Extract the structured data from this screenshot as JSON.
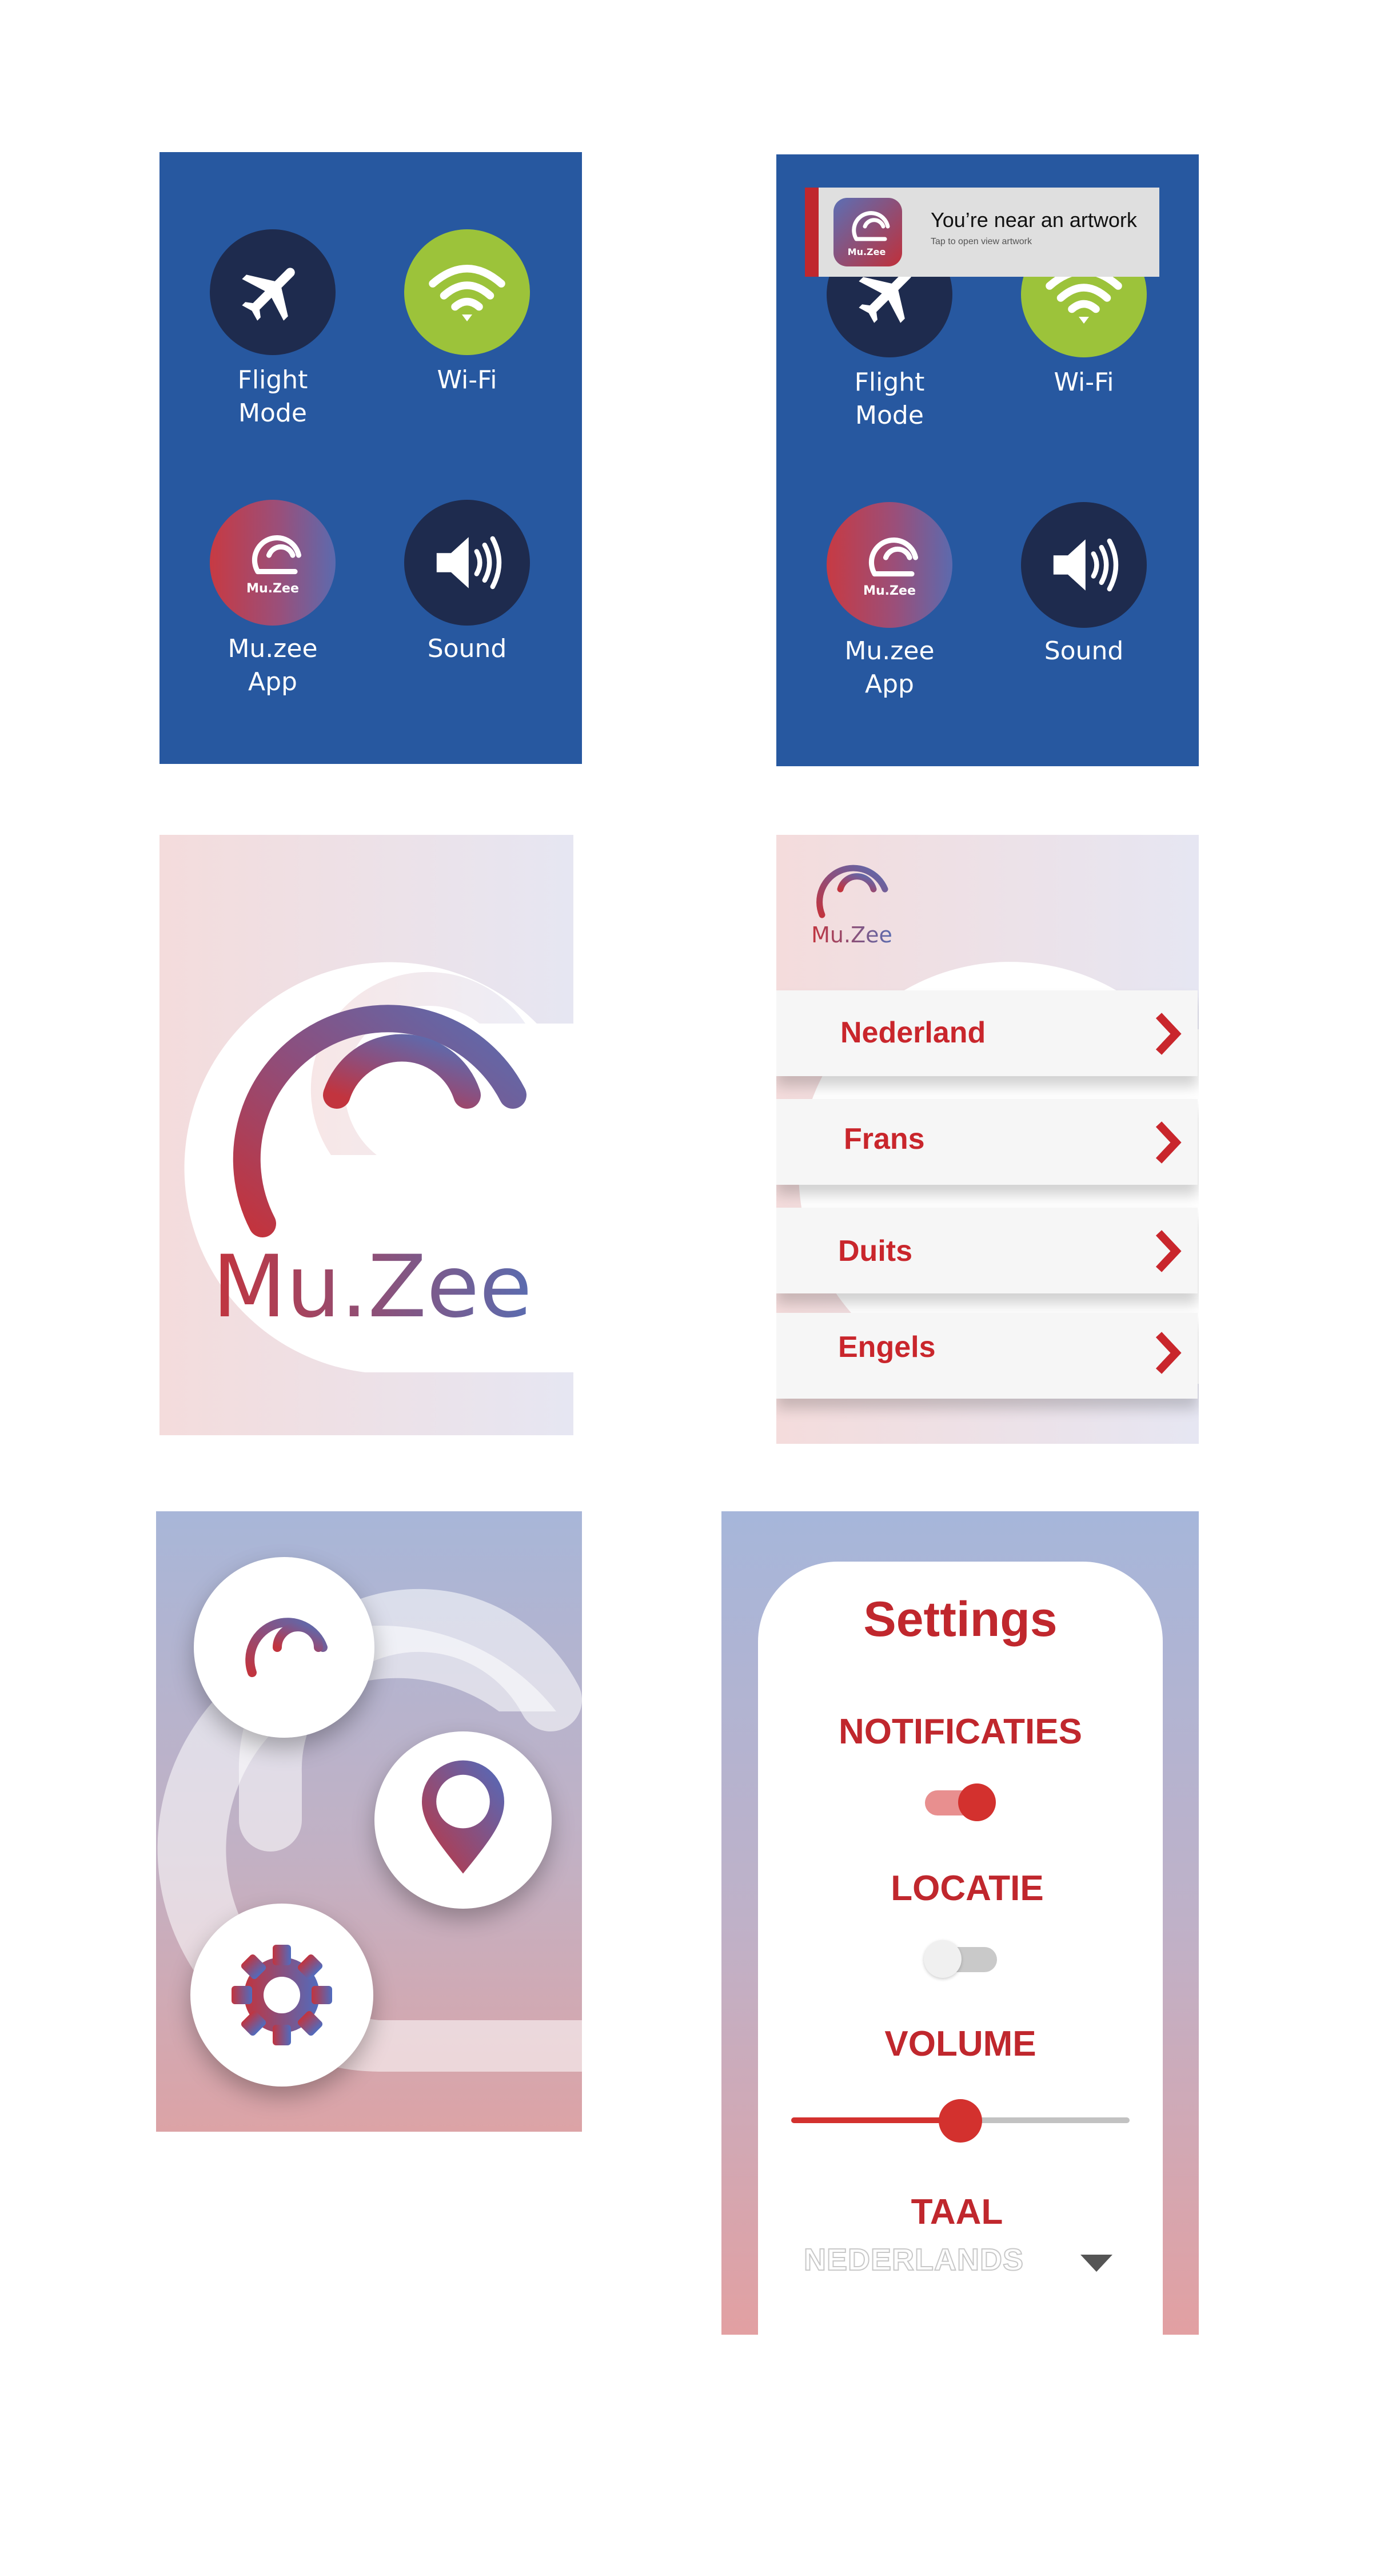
{
  "quick_settings": {
    "tiles": [
      {
        "label_1": "Flight",
        "label_2": "Mode",
        "icon": "airplane-icon"
      },
      {
        "label_1": "Wi-Fi",
        "icon": "wifi-icon"
      },
      {
        "label_1": "Mu.zee",
        "label_2": "App",
        "icon": "muzee-logo-icon"
      },
      {
        "label_1": "Sound",
        "icon": "speaker-icon"
      }
    ],
    "app_icon_text": "Mu.Zee"
  },
  "notification": {
    "title": "You’re near an artwork",
    "subtitle": "Tap to open view artwork",
    "icon_text": "Mu.Zee"
  },
  "splash": {
    "brand": "Mu.Zee"
  },
  "language_menu": {
    "logo_text": "Mu.Zee",
    "items": [
      "Nederland",
      "Frans",
      "Duits",
      "Engels"
    ]
  },
  "home": {
    "buttons": [
      "muzee-logo-icon",
      "location-pin-icon",
      "gear-icon"
    ]
  },
  "settings": {
    "title": "Settings",
    "notifications_label": "NOTIFICATIES",
    "notifications_on": true,
    "location_label": "LOCATIE",
    "location_on": false,
    "volume_label": "VOLUME",
    "volume_level": 0.5,
    "language_label": "TAAL",
    "language_value": "NEDERLANDS"
  },
  "colors": {
    "blue_bg": "#2758a0",
    "dark_tile": "#1e2b4e",
    "wifi_green": "#9cc33a",
    "brand_red": "#c0272d",
    "brand_blue": "#5c6aae"
  }
}
